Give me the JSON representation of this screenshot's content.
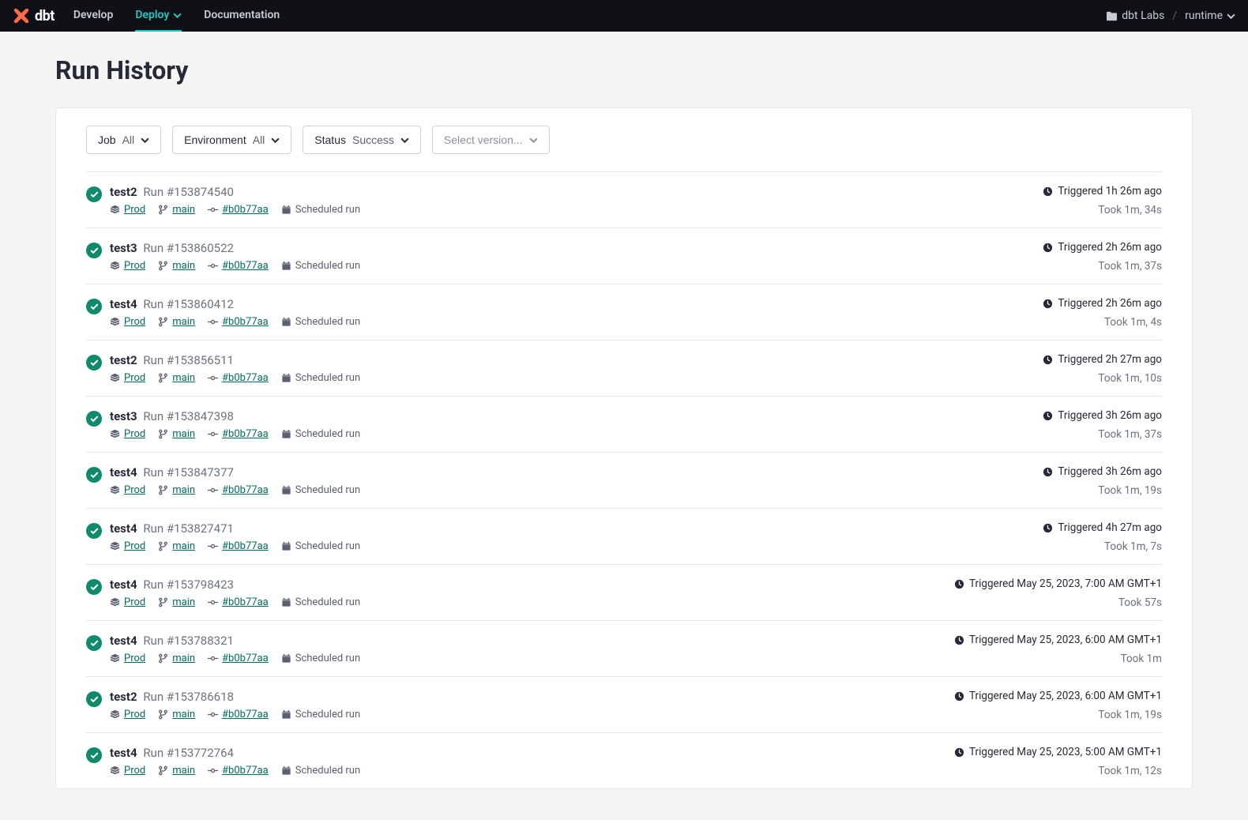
{
  "nav": {
    "brand": "dbt",
    "develop": "Develop",
    "deploy": "Deploy",
    "docs": "Documentation",
    "org": "dbt Labs",
    "project": "runtime"
  },
  "page": {
    "title": "Run History"
  },
  "filters": {
    "job_label": "Job",
    "job_value": "All",
    "env_label": "Environment",
    "env_value": "All",
    "status_label": "Status",
    "status_value": "Success",
    "version_placeholder": "Select version..."
  },
  "runs": [
    {
      "job": "test2",
      "run": "Run #153874540",
      "env": "Prod",
      "branch": "main",
      "commit": "#b0b77aa",
      "type": "Scheduled run",
      "trig": "Triggered 1h 26m ago",
      "dur": "Took 1m, 34s"
    },
    {
      "job": "test3",
      "run": "Run #153860522",
      "env": "Prod",
      "branch": "main",
      "commit": "#b0b77aa",
      "type": "Scheduled run",
      "trig": "Triggered 2h 26m ago",
      "dur": "Took 1m, 37s"
    },
    {
      "job": "test4",
      "run": "Run #153860412",
      "env": "Prod",
      "branch": "main",
      "commit": "#b0b77aa",
      "type": "Scheduled run",
      "trig": "Triggered 2h 26m ago",
      "dur": "Took 1m, 4s"
    },
    {
      "job": "test2",
      "run": "Run #153856511",
      "env": "Prod",
      "branch": "main",
      "commit": "#b0b77aa",
      "type": "Scheduled run",
      "trig": "Triggered 2h 27m ago",
      "dur": "Took 1m, 10s"
    },
    {
      "job": "test3",
      "run": "Run #153847398",
      "env": "Prod",
      "branch": "main",
      "commit": "#b0b77aa",
      "type": "Scheduled run",
      "trig": "Triggered 3h 26m ago",
      "dur": "Took 1m, 37s"
    },
    {
      "job": "test4",
      "run": "Run #153847377",
      "env": "Prod",
      "branch": "main",
      "commit": "#b0b77aa",
      "type": "Scheduled run",
      "trig": "Triggered 3h 26m ago",
      "dur": "Took 1m, 19s"
    },
    {
      "job": "test4",
      "run": "Run #153827471",
      "env": "Prod",
      "branch": "main",
      "commit": "#b0b77aa",
      "type": "Scheduled run",
      "trig": "Triggered 4h 27m ago",
      "dur": "Took 1m, 7s"
    },
    {
      "job": "test4",
      "run": "Run #153798423",
      "env": "Prod",
      "branch": "main",
      "commit": "#b0b77aa",
      "type": "Scheduled run",
      "trig": "Triggered May 25, 2023, 7:00 AM GMT+1",
      "dur": "Took 57s"
    },
    {
      "job": "test4",
      "run": "Run #153788321",
      "env": "Prod",
      "branch": "main",
      "commit": "#b0b77aa",
      "type": "Scheduled run",
      "trig": "Triggered May 25, 2023, 6:00 AM GMT+1",
      "dur": "Took 1m"
    },
    {
      "job": "test2",
      "run": "Run #153786618",
      "env": "Prod",
      "branch": "main",
      "commit": "#b0b77aa",
      "type": "Scheduled run",
      "trig": "Triggered May 25, 2023, 6:00 AM GMT+1",
      "dur": "Took 1m, 19s"
    },
    {
      "job": "test4",
      "run": "Run #153772764",
      "env": "Prod",
      "branch": "main",
      "commit": "#b0b77aa",
      "type": "Scheduled run",
      "trig": "Triggered May 25, 2023, 5:00 AM GMT+1",
      "dur": "Took 1m, 12s"
    }
  ]
}
